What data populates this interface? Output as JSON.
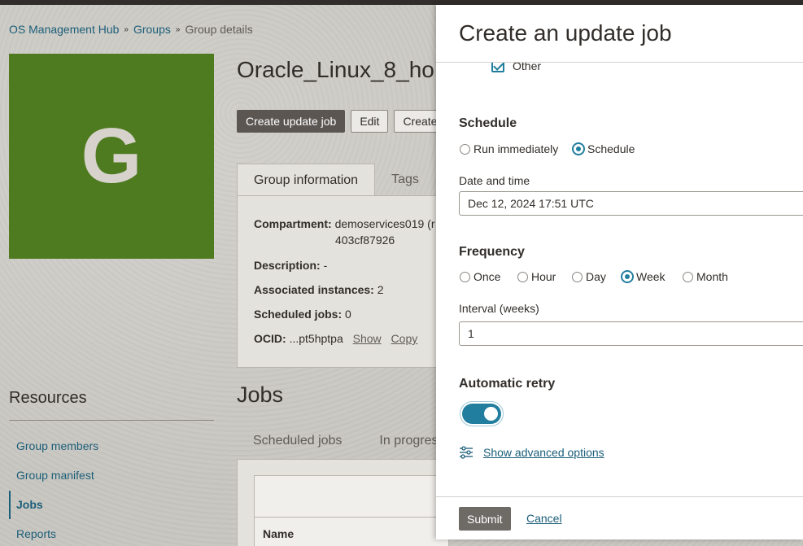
{
  "breadcrumb": {
    "items": [
      "OS Management Hub",
      "Groups"
    ],
    "current": "Group details",
    "separator": "»"
  },
  "group": {
    "initial": "G",
    "title": "Oracle_Linux_8_ho",
    "tile_color": "#4f7b20"
  },
  "actions": {
    "create_update_job": "Create update job",
    "edit": "Edit",
    "create": "Create"
  },
  "tabs": {
    "group_information": "Group information",
    "tags": "Tags"
  },
  "info": {
    "compartment_label": "Compartment:",
    "compartment_value_1": "demoservices019 (r",
    "compartment_value_2": "403cf87926",
    "description_label": "Description:",
    "description_value": "-",
    "associated_label": "Associated instances:",
    "associated_value": "2",
    "scheduled_label": "Scheduled jobs:",
    "scheduled_value": "0",
    "ocid_label": "OCID:",
    "ocid_value": "...pt5hptpa",
    "show": "Show",
    "copy": "Copy"
  },
  "resources": {
    "title": "Resources",
    "items": [
      "Group members",
      "Group manifest",
      "Jobs",
      "Reports"
    ],
    "active": "Jobs"
  },
  "jobs": {
    "title": "Jobs",
    "tabs": [
      "Scheduled jobs",
      "In progress"
    ],
    "column_name": "Name"
  },
  "drawer": {
    "title": "Create an update job",
    "other_label": "Other",
    "schedule": {
      "title": "Schedule",
      "run_immediately": "Run immediately",
      "schedule": "Schedule",
      "selected": "Schedule"
    },
    "date_time": {
      "label": "Date and time",
      "value": "Dec 12, 2024 17:51 UTC"
    },
    "frequency": {
      "title": "Frequency",
      "options": [
        "Once",
        "Hour",
        "Day",
        "Week",
        "Month"
      ],
      "selected": "Week"
    },
    "interval": {
      "label": "Interval (weeks)",
      "value": "1"
    },
    "retry": {
      "title": "Automatic retry",
      "enabled": true
    },
    "advanced_link": "Show advanced options",
    "submit": "Submit",
    "cancel": "Cancel"
  },
  "colors": {
    "accent": "#227e9e",
    "link": "#1b5e79"
  }
}
